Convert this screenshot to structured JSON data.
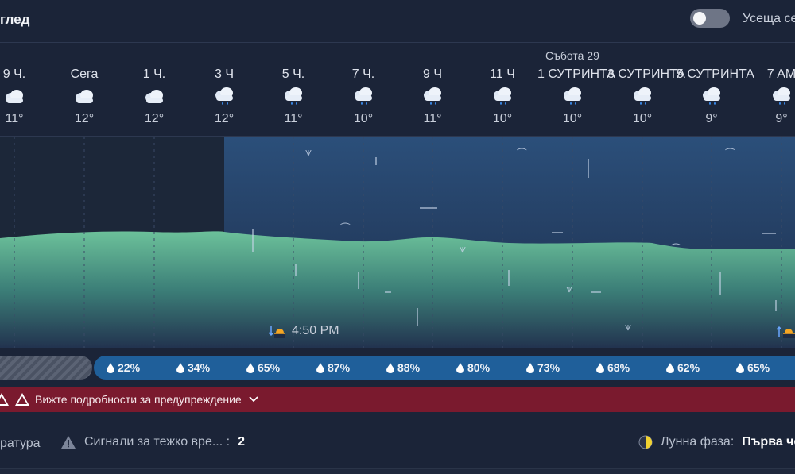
{
  "header": {
    "title": "глед",
    "toggle_label": "Усеща се"
  },
  "day_label": "Събота 29",
  "hours": [
    {
      "label": "9 Ч.",
      "icon": "cloud-icon",
      "temp": "11°"
    },
    {
      "label": "Сега",
      "icon": "cloud-icon",
      "temp": "12°"
    },
    {
      "label": "1 Ч.",
      "icon": "cloud-icon",
      "temp": "12°"
    },
    {
      "label": "3 Ч",
      "icon": "rain-cloud-icon",
      "temp": "12°"
    },
    {
      "label": "5 Ч.",
      "icon": "rain-cloud-icon",
      "temp": "11°"
    },
    {
      "label": "7 Ч.",
      "icon": "rain-cloud-icon",
      "temp": "10°"
    },
    {
      "label": "9 Ч",
      "icon": "rain-cloud-icon",
      "temp": "11°"
    },
    {
      "label": "11 Ч",
      "icon": "rain-cloud-icon",
      "temp": "10°"
    },
    {
      "label": "1 СУТРИНТА",
      "icon": "rain-cloud-icon",
      "temp": "10°"
    },
    {
      "label": "3 СУТРИНТА",
      "icon": "rain-cloud-icon",
      "temp": "10°"
    },
    {
      "label": "5 СУТРИНТА",
      "icon": "rain-cloud-icon",
      "temp": "9°"
    },
    {
      "label": "7 AM",
      "icon": "rain-cloud-icon",
      "temp": "9°"
    }
  ],
  "sunset_time": "4:50 PM",
  "precipitation": [
    "22%",
    "34%",
    "65%",
    "87%",
    "88%",
    "80%",
    "73%",
    "68%",
    "62%",
    "65%"
  ],
  "warning": {
    "text": "Вижте подробности за предупреждение"
  },
  "footer": {
    "left_label": "ратура",
    "alerts_label": "Сигнали за тежко вре... :",
    "alerts_count": "2",
    "moon_label": "Лунна фаза:",
    "moon_value": "Първа че"
  },
  "colors": {
    "background": "#1b2438",
    "rain_band": "#5fb38f",
    "precip_bar": "#1f5f9a",
    "warning_banner": "#7a1a2e"
  }
}
